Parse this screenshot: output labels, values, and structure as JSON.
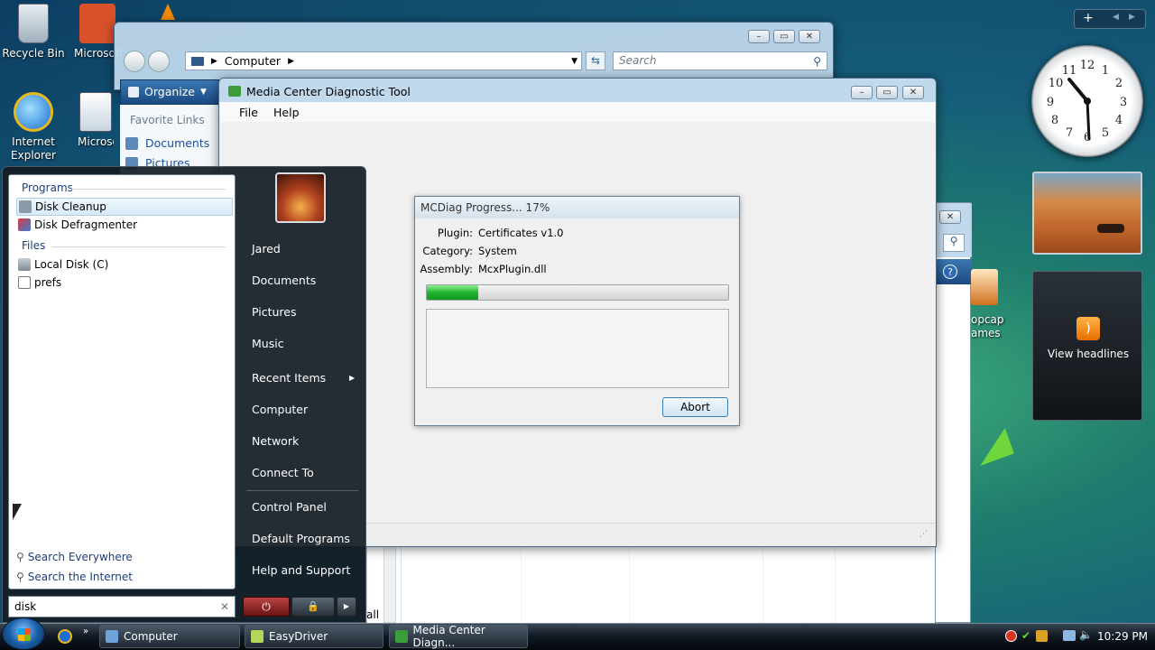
{
  "desktop": {
    "icons": [
      {
        "label": "Recycle Bin"
      },
      {
        "label": "Microsoft Office P"
      },
      {
        "label": "Internet Explorer"
      },
      {
        "label": "Microsoft Office P"
      }
    ],
    "popcap_label": "opcap\names"
  },
  "explorer": {
    "address": "Computer",
    "search_placeholder": "Search",
    "organize": "Organize",
    "favorite_links": "Favorite Links",
    "links": [
      "Documents",
      "Pictures"
    ]
  },
  "mcdiag": {
    "title": "Media Center Diagnostic Tool",
    "menu": [
      "File",
      "Help"
    ],
    "progress_title": "MCDiag Progress... 17%",
    "progress_percent": 17,
    "plugin_label": "Plugin:",
    "plugin_value": "Certificates v1.0",
    "category_label": "Category:",
    "category_value": "System",
    "assembly_label": "Assembly:",
    "assembly_value": "McxPlugin.dll",
    "abort": "Abort"
  },
  "start_menu": {
    "programs_header": "Programs",
    "programs": [
      "Disk Cleanup",
      "Disk Defragmenter"
    ],
    "files_header": "Files",
    "files": [
      "Local Disk (C)",
      "prefs"
    ],
    "search_everywhere": "Search Everywhere",
    "search_internet": "Search the Internet",
    "search_value": "disk",
    "right_items": [
      "Jared",
      "Documents",
      "Pictures",
      "Music",
      "Recent Items",
      "Computer",
      "Network",
      "Connect To",
      "Control Panel",
      "Default Programs",
      "Help and Support"
    ]
  },
  "sidebar": {
    "headlines": "View headlines"
  },
  "taskbar": {
    "buttons": [
      "Computer",
      "EasyDriver",
      "Media Center Diagn..."
    ],
    "clock": "10:29 PM"
  },
  "colors": {
    "progress_fill": "#21b531",
    "taskbar": "#101820",
    "start_menu_right": "#1b1b1b"
  }
}
